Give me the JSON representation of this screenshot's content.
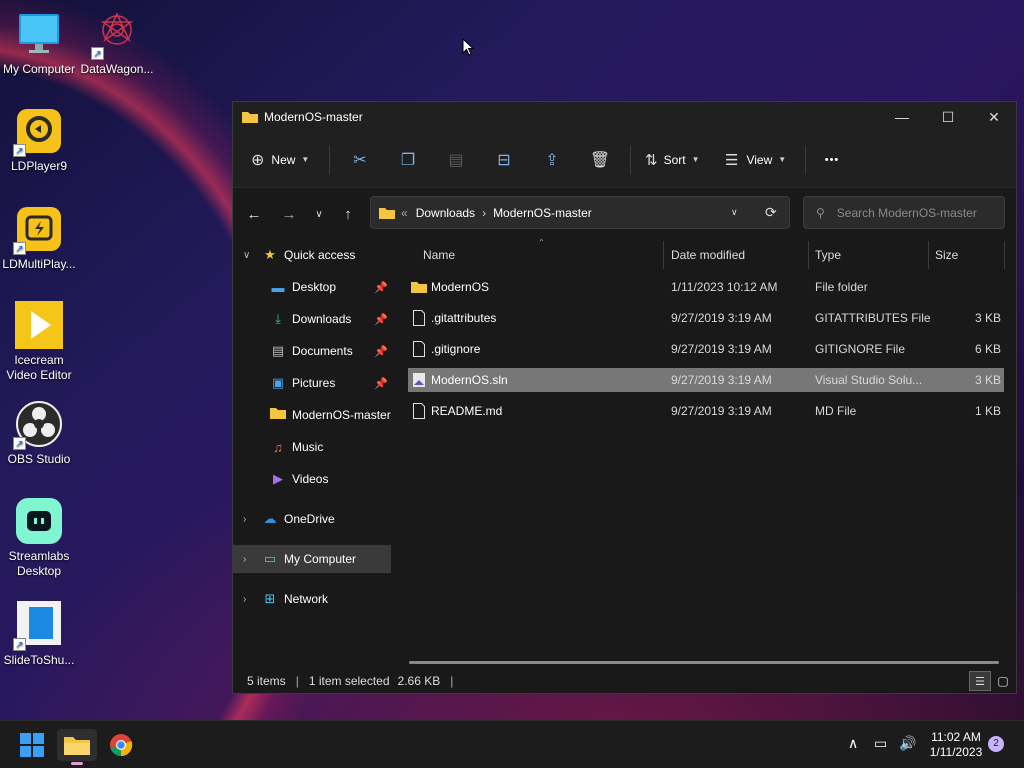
{
  "desktop": {
    "icons": [
      {
        "label": "My Computer"
      },
      {
        "label": "DataWagon..."
      },
      {
        "label": "LDPlayer9"
      },
      {
        "label": "LDMultiPlay..."
      },
      {
        "label": "Icecream Video Editor"
      },
      {
        "label": "OBS Studio"
      },
      {
        "label": "Streamlabs Desktop"
      },
      {
        "label": "SlideToShu..."
      }
    ]
  },
  "window": {
    "title": "ModernOS-master",
    "controls": {
      "minimize": "—",
      "maximize": "☐",
      "close": "✕"
    }
  },
  "toolbar": {
    "new_label": "New",
    "sort_label": "Sort",
    "view_label": "View",
    "more_label": "•••"
  },
  "address": {
    "crumbs": [
      "Downloads",
      "ModernOS-master"
    ],
    "prefix": "«",
    "separator": "›"
  },
  "search": {
    "placeholder": "Search ModernOS-master"
  },
  "nav": {
    "items": [
      {
        "label": "Quick access",
        "icon": "star-icon"
      },
      {
        "label": "Desktop",
        "icon": "desktop-icon",
        "pinned": true
      },
      {
        "label": "Downloads",
        "icon": "download-icon",
        "pinned": true
      },
      {
        "label": "Documents",
        "icon": "document-icon",
        "pinned": true
      },
      {
        "label": "Pictures",
        "icon": "picture-icon",
        "pinned": true
      },
      {
        "label": "ModernOS-master",
        "icon": "folder-icon"
      },
      {
        "label": "Music",
        "icon": "music-icon"
      },
      {
        "label": "Videos",
        "icon": "video-icon"
      },
      {
        "label": "OneDrive",
        "icon": "cloud-icon"
      },
      {
        "label": "My Computer",
        "icon": "computer-icon",
        "selected": true
      },
      {
        "label": "Network",
        "icon": "network-icon"
      }
    ]
  },
  "files": {
    "columns": [
      "Name",
      "Date modified",
      "Type",
      "Size"
    ],
    "rows": [
      {
        "name": "ModernOS",
        "date": "1/11/2023 10:12 AM",
        "type": "File folder",
        "size": "",
        "icon": "folder-icon"
      },
      {
        "name": ".gitattributes",
        "date": "9/27/2019 3:19 AM",
        "type": "GITATTRIBUTES File",
        "size": "3 KB",
        "icon": "file-icon"
      },
      {
        "name": ".gitignore",
        "date": "9/27/2019 3:19 AM",
        "type": "GITIGNORE File",
        "size": "6 KB",
        "icon": "file-icon"
      },
      {
        "name": "ModernOS.sln",
        "date": "9/27/2019 3:19 AM",
        "type": "Visual Studio Solu...",
        "size": "3 KB",
        "icon": "solution-file-icon",
        "selected": true
      },
      {
        "name": "README.md",
        "date": "9/27/2019 3:19 AM",
        "type": "MD File",
        "size": "1 KB",
        "icon": "file-icon"
      }
    ]
  },
  "status": {
    "items": "5 items",
    "selection": "1 item selected",
    "size": "2.66 KB",
    "separator": "|"
  },
  "taskbar": {
    "clock_time": "11:02 AM",
    "clock_date": "1/11/2023",
    "notification_count": "2"
  },
  "colors": {
    "accent": "#7fb3ea",
    "folder": "#f4c542",
    "selected_row": "#777777"
  }
}
